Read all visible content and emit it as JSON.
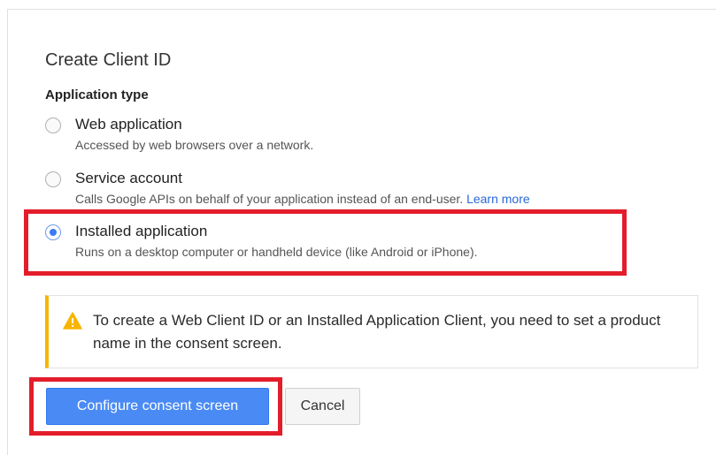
{
  "dialog": {
    "title": "Create Client ID",
    "application_type_label": "Application type"
  },
  "options": [
    {
      "label": "Web application",
      "description": "Accessed by web browsers over a network.",
      "selected": false
    },
    {
      "label": "Service account",
      "description": "Calls Google APIs on behalf of your application instead of an end-user.",
      "link": "Learn more",
      "selected": false
    },
    {
      "label": "Installed application",
      "description": "Runs on a desktop computer or handheld device (like Android or iPhone).",
      "selected": true
    }
  ],
  "notice": {
    "icon": "warning-icon",
    "text": "To create a Web Client ID or an Installed Application Client, you need to set a product name in the consent screen."
  },
  "buttons": {
    "configure_label": "Configure consent screen",
    "cancel_label": "Cancel"
  },
  "colors": {
    "primary_button": "#4a8af4",
    "link": "#2a68d8",
    "warning_accent": "#f7b500",
    "highlight_annotation": "#e31d2b",
    "radio_selected": "#3b7cf0"
  }
}
